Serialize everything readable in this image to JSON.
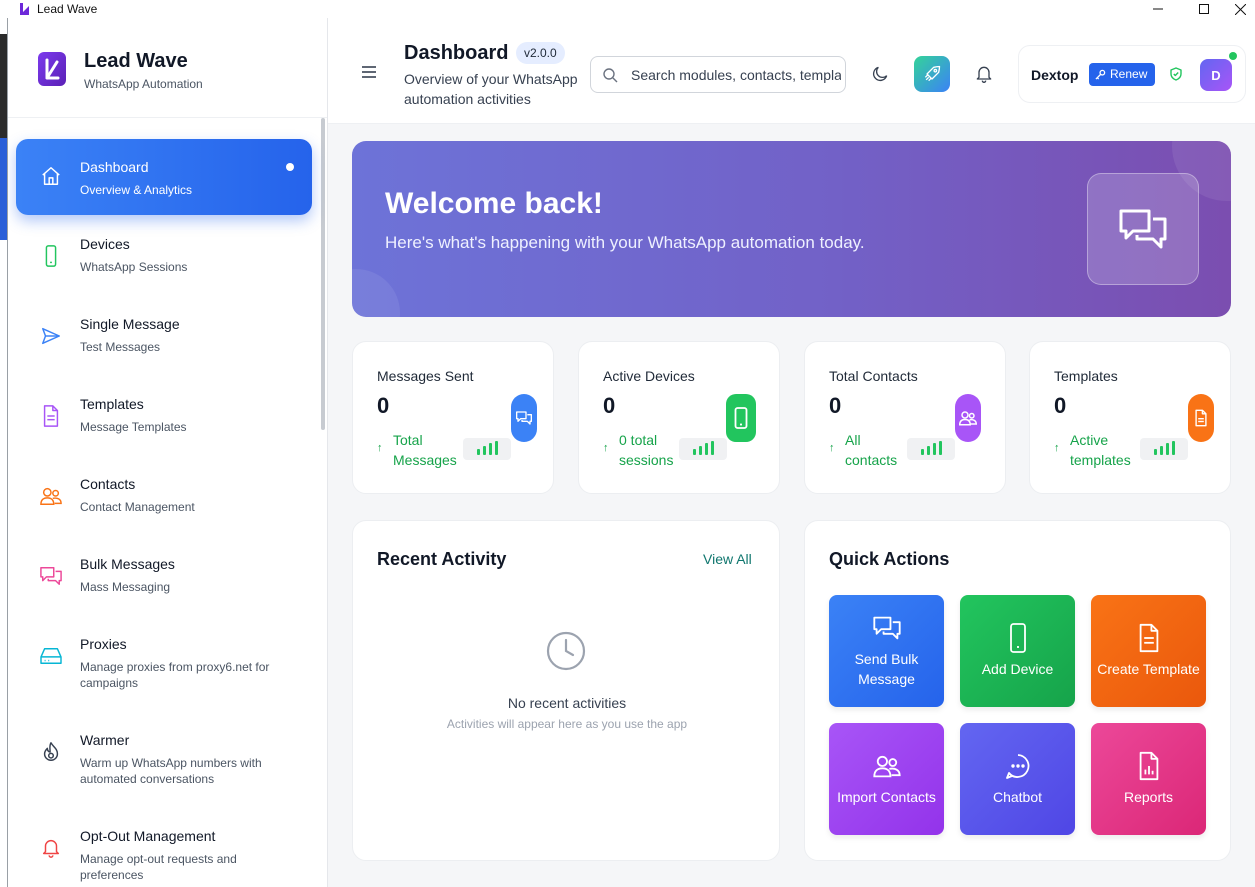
{
  "window": {
    "title": "Lead Wave"
  },
  "brand": {
    "name": "Lead Wave",
    "subtitle": "WhatsApp Automation"
  },
  "sidebar": {
    "items": [
      {
        "label": "Dashboard",
        "desc": "Overview & Analytics",
        "icon": "home-icon",
        "active": true
      },
      {
        "label": "Devices",
        "desc": "WhatsApp Sessions",
        "icon": "smartphone-icon"
      },
      {
        "label": "Single Message",
        "desc": "Test Messages",
        "icon": "send-icon"
      },
      {
        "label": "Templates",
        "desc": "Message Templates",
        "icon": "file-text-icon"
      },
      {
        "label": "Contacts",
        "desc": "Contact Management",
        "icon": "users-icon"
      },
      {
        "label": "Bulk Messages",
        "desc": "Mass Messaging",
        "icon": "messages-icon"
      },
      {
        "label": "Proxies",
        "desc": "Manage proxies from proxy6.net for campaigns",
        "icon": "hard-drive-icon"
      },
      {
        "label": "Warmer",
        "desc": "Warm up WhatsApp numbers with automated conversations",
        "icon": "flame-icon"
      },
      {
        "label": "Opt-Out Management",
        "desc": "Manage opt-out requests and preferences",
        "icon": "bell-off-icon"
      }
    ]
  },
  "header": {
    "title": "Dashboard",
    "version": "v2.0.0",
    "subtitle": "Overview of your WhatsApp automation activities",
    "search": {
      "placeholder": "Search modules, contacts, templates...",
      "value": ""
    },
    "user": {
      "name": "Dextop",
      "renew_label": "Renew",
      "avatar_initial": "D"
    }
  },
  "hero": {
    "title": "Welcome back!",
    "subtitle": "Here's what's happening with your WhatsApp automation today."
  },
  "stats": [
    {
      "label": "Messages Sent",
      "value": "0",
      "trend": "Total Messages",
      "color": "#3b82f6",
      "icon": "messages-icon"
    },
    {
      "label": "Active Devices",
      "value": "0",
      "trend": "0 total sessions",
      "color": "#22c55e",
      "icon": "smartphone-icon"
    },
    {
      "label": "Total Contacts",
      "value": "0",
      "trend": "All contacts",
      "color": "#a855f7",
      "icon": "users-icon"
    },
    {
      "label": "Templates",
      "value": "0",
      "trend": "Active templates",
      "color": "#f97316",
      "icon": "file-text-icon"
    }
  ],
  "recent": {
    "title": "Recent Activity",
    "view_all": "View All",
    "empty_title": "No recent activities",
    "empty_sub": "Activities will appear here as you use the app"
  },
  "quick": {
    "title": "Quick Actions",
    "actions": [
      {
        "label": "Send Bulk Message",
        "color": "#2563eb",
        "icon": "messages-icon"
      },
      {
        "label": "Add Device",
        "color": "#16a34a",
        "icon": "smartphone-icon"
      },
      {
        "label": "Create Template",
        "color": "#ea580c",
        "icon": "file-text-icon"
      },
      {
        "label": "Import Contacts",
        "color": "#9333ea",
        "icon": "users-icon"
      },
      {
        "label": "Chatbot",
        "color": "#4f46e5",
        "icon": "chat-dots-icon"
      },
      {
        "label": "Reports",
        "color": "#db2777",
        "icon": "report-icon"
      }
    ]
  }
}
